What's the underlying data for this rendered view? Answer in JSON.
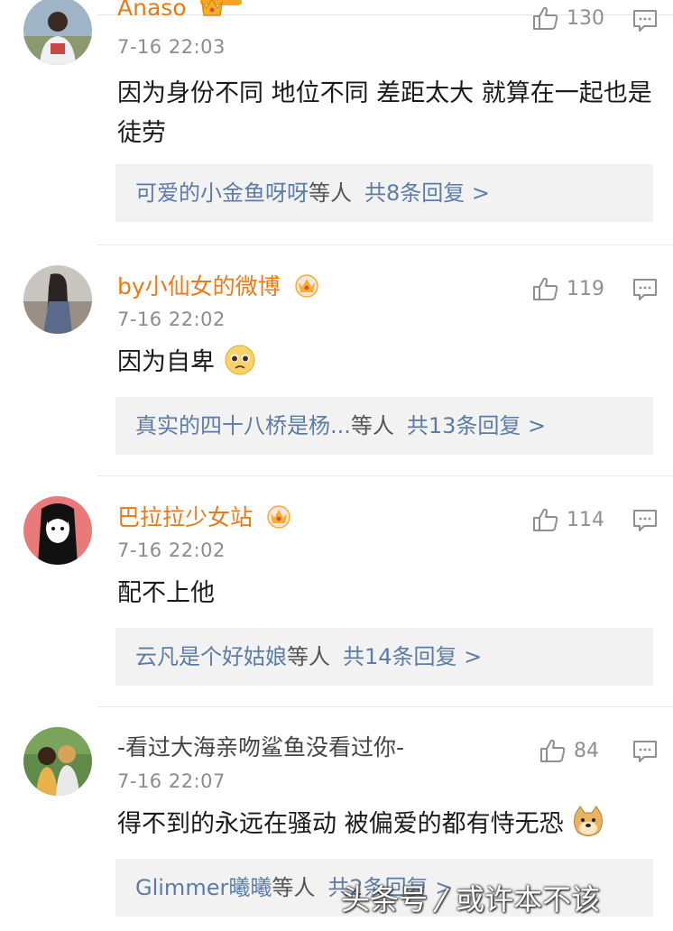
{
  "comments": [
    {
      "user": "Anaso",
      "time": "7-16 22:03",
      "likes": "130",
      "text": "因为身份不同 地位不同 差距太大 就算在一起也是徒劳",
      "reply_names": "可爱的小金鱼呀呀",
      "reply_suffix": "等人",
      "reply_count": "共8条回复 >"
    },
    {
      "user": "by小仙女的微博",
      "time": "7-16 22:02",
      "likes": "119",
      "text": "因为自卑",
      "emoji": "pleading-face",
      "reply_names": "真实的四十八桥是杨...",
      "reply_suffix": "等人",
      "reply_count": "共13条回复 >"
    },
    {
      "user": "巴拉拉少女站",
      "time": "7-16 22:02",
      "likes": "114",
      "text": "配不上他",
      "reply_names": "云凡是个好姑娘",
      "reply_suffix": "等人",
      "reply_count": "共14条回复 >"
    },
    {
      "user": "-看过大海亲吻鲨鱼没看过你-",
      "time": "7-16 22:07",
      "likes": "84",
      "text": "得不到的永远在骚动 被偏爱的都有恃无恐",
      "emoji": "doge",
      "reply_names": "Glimmer曦曦",
      "reply_suffix": "等人",
      "reply_count": "共2条回复 >"
    }
  ],
  "watermark": {
    "left": "头条号",
    "slash": "/",
    "right": "或许本不该"
  },
  "colors": {
    "username": "#e97a16",
    "reply_link": "#5b7ca8",
    "timestamp": "#8c8c8c",
    "reply_box_bg": "#f2f2f2",
    "accent": "#f5a623"
  }
}
